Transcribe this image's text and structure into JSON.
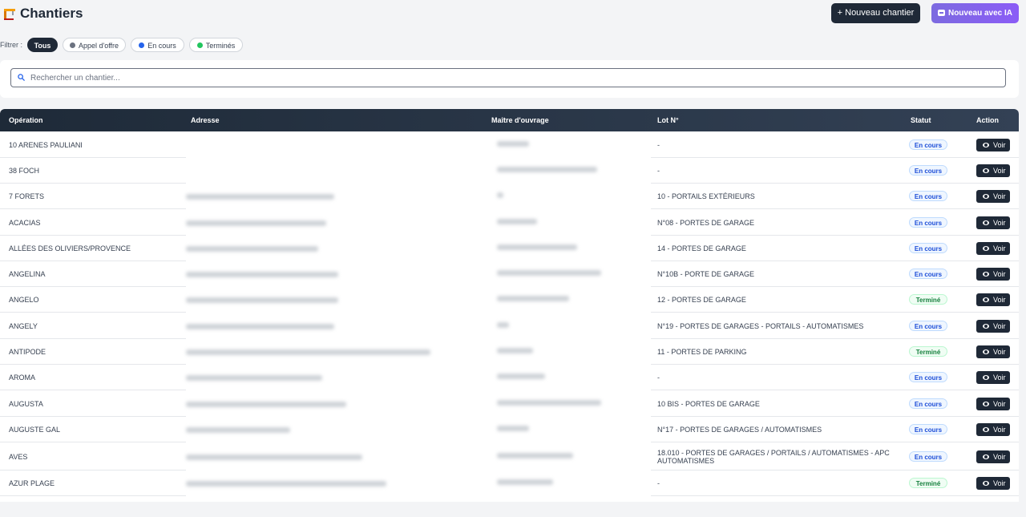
{
  "header": {
    "title": "Chantiers",
    "new_button": "+ Nouveau chantier",
    "ai_button": "Nouveau avec IA"
  },
  "filters": {
    "label": "Filtrer :",
    "chips": [
      {
        "label": "Tous",
        "active": true
      },
      {
        "label": "Appel d'offre",
        "dot_color": "#6b7280"
      },
      {
        "label": "En cours",
        "dot_color": "#2563eb"
      },
      {
        "label": "Terminés",
        "dot_color": "#22c55e"
      }
    ]
  },
  "search": {
    "placeholder": "Rechercher un chantier..."
  },
  "table": {
    "columns": [
      "Opération",
      "Adresse",
      "Maître d'ouvrage",
      "Lot N°",
      "Statut",
      "Action"
    ],
    "action_label": "Voir",
    "rows": [
      {
        "operation": "10 ARENES PAULIANI",
        "lot": "-",
        "status": "En cours"
      },
      {
        "operation": "38 FOCH",
        "lot": "-",
        "status": "En cours"
      },
      {
        "operation": "7 FORETS",
        "lot": "10 - PORTAILS EXTÉRIEURS",
        "status": "En cours"
      },
      {
        "operation": "ACACIAS",
        "lot": "N°08 - PORTES DE GARAGE",
        "status": "En cours"
      },
      {
        "operation": "ALLÉES DES OLIVIERS/PROVENCE",
        "lot": "14 - PORTES DE GARAGE",
        "status": "En cours"
      },
      {
        "operation": "ANGELINA",
        "lot": "N°10B - PORTE DE GARAGE",
        "status": "En cours"
      },
      {
        "operation": "ANGELO",
        "lot": "12 - PORTES DE GARAGE",
        "status": "Terminé"
      },
      {
        "operation": "ANGELY",
        "lot": "N°19 - PORTES DE GARAGES - PORTAILS - AUTOMATISMES",
        "status": "En cours"
      },
      {
        "operation": "ANTIPODE",
        "lot": "11 - PORTES DE PARKING",
        "status": "Terminé"
      },
      {
        "operation": "AROMA",
        "lot": "-",
        "status": "En cours"
      },
      {
        "operation": "AUGUSTA",
        "lot": "10 BIS - PORTES DE GARAGE",
        "status": "En cours"
      },
      {
        "operation": "AUGUSTE GAL",
        "lot": "N°17 - PORTES DE GARAGES / AUTOMATISMES",
        "status": "En cours"
      },
      {
        "operation": "AVES",
        "lot": "18.010 - PORTES DE GARAGES / PORTAILS / AUTOMATISMES - APC AUTOMATISMES",
        "status": "En cours"
      },
      {
        "operation": "AZUR PLAGE",
        "lot": "-",
        "status": "Terminé"
      }
    ]
  },
  "colors": {
    "dark": "#1f2937",
    "ai_gradient": [
      "#7c6ae0",
      "#8b5cf6"
    ],
    "status_en_cours": "#1d4ed8",
    "status_termine": "#15803d"
  }
}
